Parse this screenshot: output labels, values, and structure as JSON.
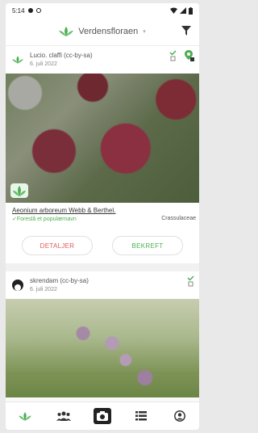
{
  "status": {
    "time": "5:14"
  },
  "appbar": {
    "title": "Verdensfloraen"
  },
  "post1": {
    "user": "Lucio. claffi (cc-by-sa)",
    "date": "6. juli 2022",
    "species": "Aeonium arboreum Webb & Berthel.",
    "suggestion": "✓Foreslå et populærnavn",
    "family": "Crassulaceae",
    "reject_label": "DETALJER",
    "confirm_label": "BEKREFT"
  },
  "post2": {
    "user": "skrendam (cc-by-sa)",
    "date": "6. juli 2022"
  },
  "colors": {
    "accent": "#4caf50",
    "reject": "#e05a5a"
  }
}
